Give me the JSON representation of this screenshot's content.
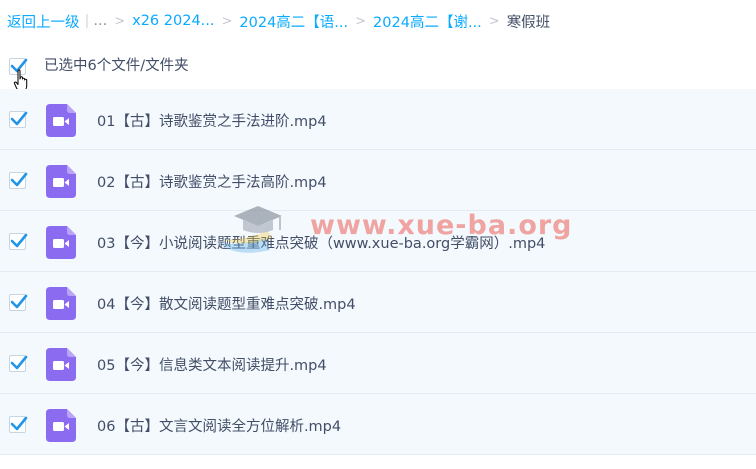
{
  "breadcrumb": {
    "back": "返回上一级",
    "ellipsis": "...",
    "crumbs": [
      "x26 2024...",
      "2024高二【语...",
      "2024高二【谢..."
    ],
    "current": "寒假班"
  },
  "selection": {
    "label": "已选中6个文件/文件夹",
    "checked": true
  },
  "files": [
    {
      "name": "01【古】诗歌鉴赏之手法进阶.mp4",
      "checked": true,
      "icon": "video-file-icon"
    },
    {
      "name": "02【古】诗歌鉴赏之手法高阶.mp4",
      "checked": true,
      "icon": "video-file-icon"
    },
    {
      "name": "03【今】小说阅读题型重难点突破（www.xue-ba.org学霸网）.mp4",
      "checked": true,
      "icon": "video-file-icon"
    },
    {
      "name": "04【今】散文阅读题型重难点突破.mp4",
      "checked": true,
      "icon": "video-file-icon"
    },
    {
      "name": "05【今】信息类文本阅读提升.mp4",
      "checked": true,
      "icon": "video-file-icon"
    },
    {
      "name": "06【古】文言文阅读全方位解析.mp4",
      "checked": true,
      "icon": "video-file-icon"
    }
  ],
  "watermark": {
    "text": "www.xue-ba.org"
  },
  "colors": {
    "link": "#09aaff",
    "checkbox": "#2196e8",
    "row_bg": "#f4f9fd",
    "video_icon": "#8b6bf0",
    "text": "#424e67"
  }
}
